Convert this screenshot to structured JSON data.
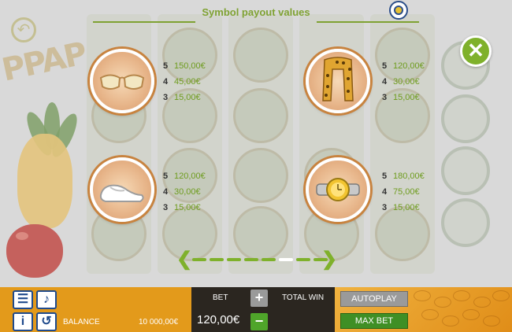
{
  "header": {
    "title": "Symbol payout values"
  },
  "logo_text": "PPAP",
  "symbols": [
    {
      "name": "sunglasses",
      "payouts": [
        {
          "count": "5",
          "value": "150,00€"
        },
        {
          "count": "4",
          "value": "45,00€"
        },
        {
          "count": "3",
          "value": "15,00€"
        }
      ]
    },
    {
      "name": "leopard-scarf",
      "payouts": [
        {
          "count": "5",
          "value": "120,00€"
        },
        {
          "count": "4",
          "value": "30,00€"
        },
        {
          "count": "3",
          "value": "15,00€"
        }
      ]
    },
    {
      "name": "white-shoe",
      "payouts": [
        {
          "count": "5",
          "value": "120,00€"
        },
        {
          "count": "4",
          "value": "30,00€"
        },
        {
          "count": "3",
          "value": "15,00€"
        }
      ]
    },
    {
      "name": "gold-watch",
      "payouts": [
        {
          "count": "5",
          "value": "180,00€"
        },
        {
          "count": "4",
          "value": "75,00€"
        },
        {
          "count": "3",
          "value": "15,00€"
        }
      ]
    }
  ],
  "pagination": {
    "pages": 8,
    "active": 6
  },
  "footer": {
    "balance_label": "BALANCE",
    "balance_value": "10 000,00€",
    "bet_label": "BET",
    "bet_value": "120,00€",
    "total_win_label": "TOTAL WIN",
    "autoplay_label": "AUTOPLAY",
    "max_bet_label": "MAX BET",
    "plus_label": "+",
    "minus_label": "−"
  },
  "colors": {
    "accent_green": "#7fb12b",
    "payout_green": "#6e9c1e",
    "bar_orange": "#e39a1b",
    "bar_dark": "#2b2620"
  }
}
